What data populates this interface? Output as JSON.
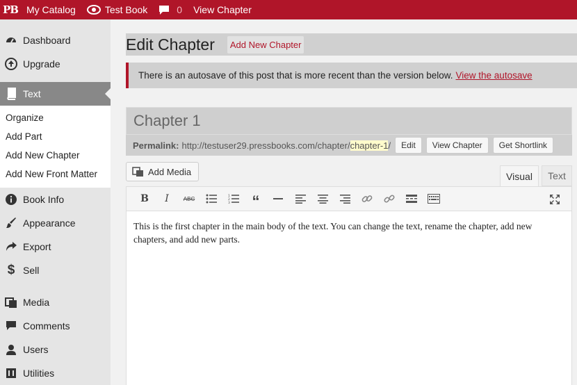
{
  "adminbar": {
    "logo": "PB",
    "my_catalog": "My Catalog",
    "book": "Test Book",
    "comment_count": "0",
    "view": "View Chapter"
  },
  "sidebar": {
    "items_top": [
      {
        "label": "Dashboard",
        "icon": "dashboard-icon"
      },
      {
        "label": "Upgrade",
        "icon": "upgrade-icon"
      }
    ],
    "current": {
      "label": "Text",
      "icon": "book-icon"
    },
    "submenu": [
      "Organize",
      "Add Part",
      "Add New Chapter",
      "Add New Front Matter"
    ],
    "items_bottom": [
      {
        "label": "Book Info",
        "icon": "info-icon"
      },
      {
        "label": "Appearance",
        "icon": "brush-icon"
      },
      {
        "label": "Export",
        "icon": "share-icon"
      },
      {
        "label": "Sell",
        "icon": "dollar-icon"
      },
      {
        "label": "Media",
        "icon": "media-icon"
      },
      {
        "label": "Comments",
        "icon": "comment-icon"
      },
      {
        "label": "Users",
        "icon": "user-icon"
      },
      {
        "label": "Utilities",
        "icon": "tools-icon"
      }
    ]
  },
  "main": {
    "title": "Edit Chapter",
    "add_new": "Add New Chapter",
    "notice_text": "There is an autosave of this post that is more recent than the version below.",
    "notice_link": "View the autosave",
    "post_title": "Chapter 1",
    "permalink_label": "Permalink:",
    "permalink_base": "http://testuser29.pressbooks.com/chapter/",
    "permalink_slug": "chapter-1",
    "permalink_end": "/",
    "edit_btn": "Edit",
    "view_btn": "View Chapter",
    "shortlink_btn": "Get Shortlink",
    "add_media": "Add Media",
    "tab_visual": "Visual",
    "tab_text": "Text",
    "body_text": "This is the first chapter in the main body of the text. You can change the text, rename the chapter, add new chapters, and add new parts."
  },
  "colors": {
    "brand": "#b01529",
    "sidebar_bg": "#e5e5e5",
    "current_bg": "#888888"
  }
}
